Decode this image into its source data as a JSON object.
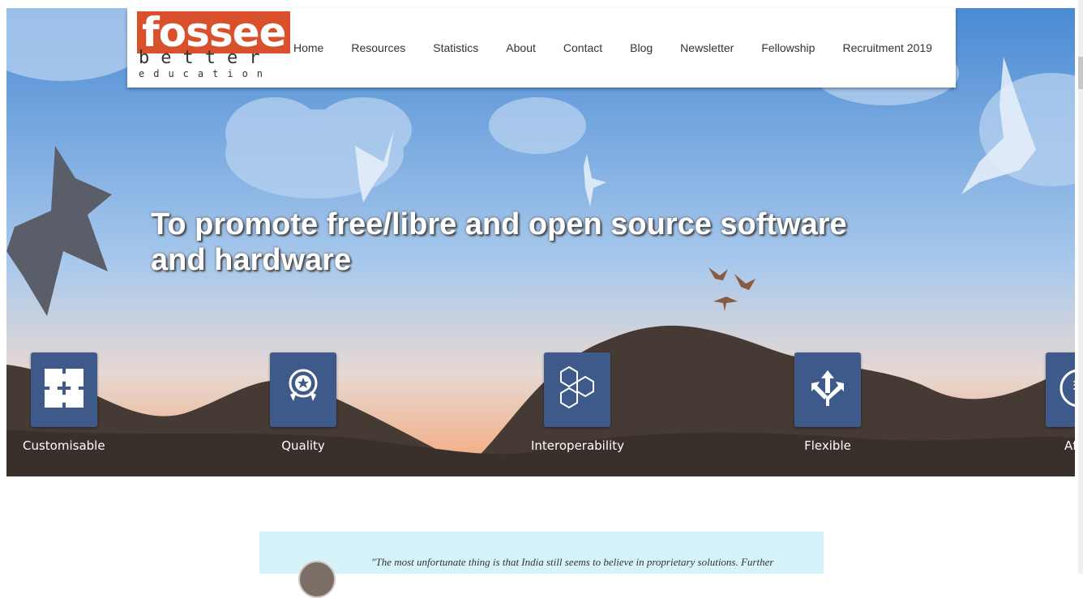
{
  "brand": {
    "logo_line1": "fossee",
    "logo_line2": "better",
    "logo_line3": "education",
    "accent_color": "#d9512c"
  },
  "nav": {
    "items": [
      {
        "label": "Home"
      },
      {
        "label": "Resources"
      },
      {
        "label": "Statistics"
      },
      {
        "label": "About"
      },
      {
        "label": "Contact"
      },
      {
        "label": "Blog"
      },
      {
        "label": "Newsletter"
      },
      {
        "label": "Fellowship"
      },
      {
        "label": "Recruitment 2019"
      }
    ]
  },
  "hero": {
    "headline": "To promote free/libre and open source software and hardware",
    "sky_color_top": "#4a8ad4",
    "hill_color": "#463a34"
  },
  "features": [
    {
      "label": "Customisable",
      "icon": "puzzle-icon"
    },
    {
      "label": "Quality",
      "icon": "award-badge-icon"
    },
    {
      "label": "Interoperability",
      "icon": "hexagons-icon"
    },
    {
      "label": "Flexible",
      "icon": "arrows-branch-icon"
    },
    {
      "label": "Affor",
      "icon": "rupee-icon"
    }
  ],
  "quote": {
    "text": "\"The most unfortunate thing is that India still seems to believe in proprietary solutions. Further"
  }
}
